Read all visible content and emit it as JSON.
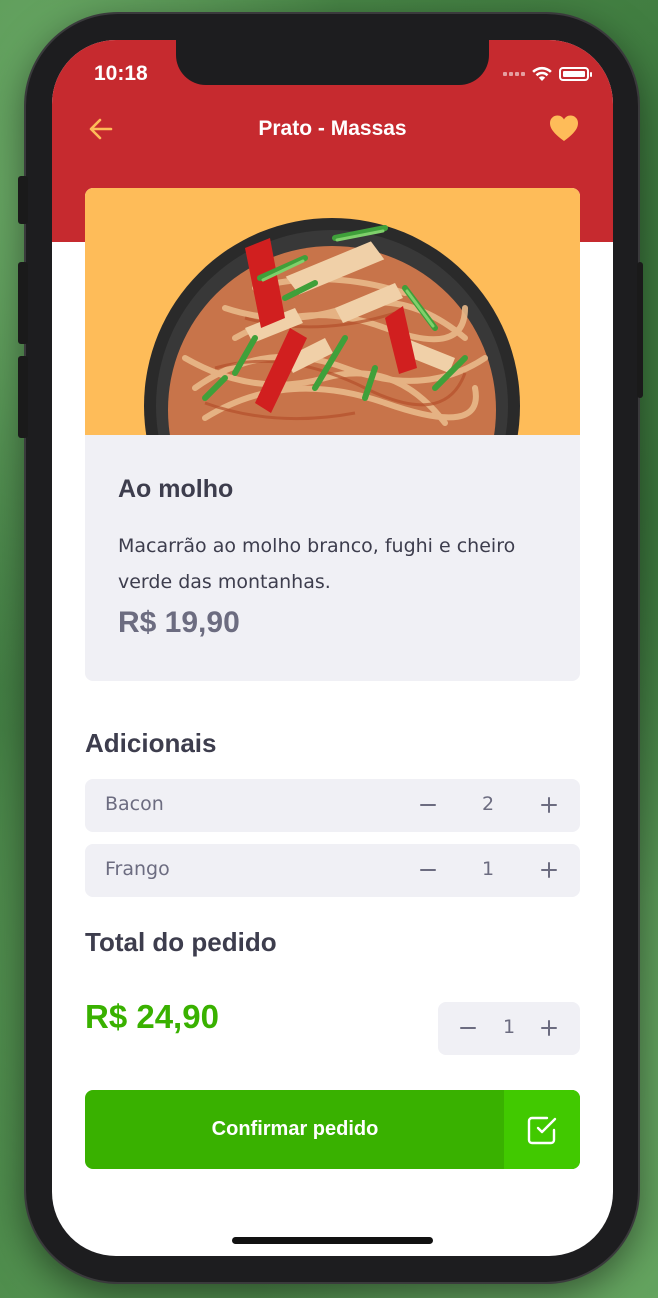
{
  "status_bar": {
    "time": "10:18"
  },
  "header": {
    "title": "Prato - Massas"
  },
  "dish": {
    "name": "Ao molho",
    "description": "Macarrão ao molho branco, fughi e cheiro verde das montanhas.",
    "price": "R$ 19,90"
  },
  "extras": {
    "title": "Adicionais",
    "items": [
      {
        "name": "Bacon",
        "quantity": "2"
      },
      {
        "name": "Frango",
        "quantity": "1"
      }
    ]
  },
  "total": {
    "title": "Total do pedido",
    "value": "R$ 24,90",
    "quantity": "1"
  },
  "confirm": {
    "label": "Confirmar pedido"
  },
  "icons": {
    "back": "arrow-left-icon",
    "favorite": "heart-icon",
    "minus": "minus-icon",
    "plus": "plus-icon",
    "confirm": "check-square-icon"
  },
  "colors": {
    "header": "#c62a2f",
    "accent_orange": "#febc59",
    "green": "#39b100",
    "green_light": "#41c900",
    "card_bg": "#f0f0f5",
    "text_dark": "#3d3d4d",
    "text_muted": "#6c6c80"
  }
}
